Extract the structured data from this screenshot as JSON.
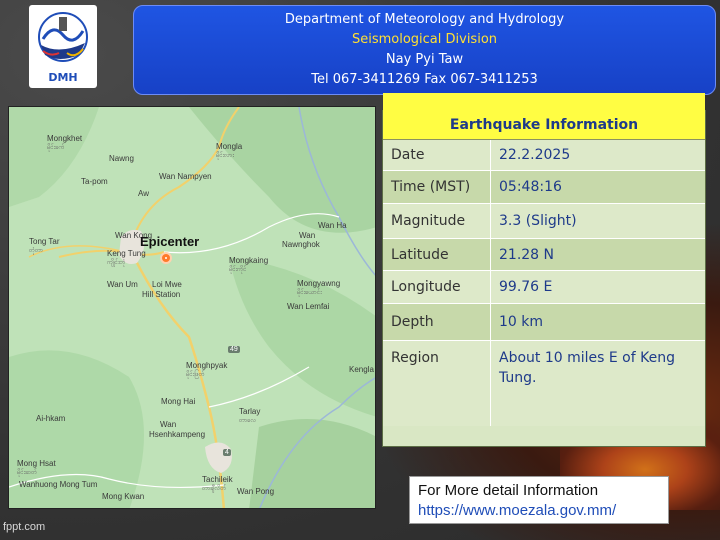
{
  "logo": {
    "text": "DMH"
  },
  "header": {
    "line1": "Department of Meteorology and Hydrology",
    "line2": "Seismological Division",
    "line3": "Nay Pyi Taw",
    "line4": "Tel 067-3411269 Fax 067-3411253"
  },
  "map": {
    "epicenter_label": "Epicenter",
    "route_shield_1": "49",
    "route_shield_2": "4",
    "places": [
      {
        "name": "Mongkhet",
        "sub": "မိုင်းခက်"
      },
      {
        "name": "Nawng",
        "sub": ""
      },
      {
        "name": "Ta-pom",
        "sub": ""
      },
      {
        "name": "Mongla",
        "sub": "မိုင်းလား"
      },
      {
        "name": "Wan Nampyen",
        "sub": ""
      },
      {
        "name": "Aw",
        "sub": ""
      },
      {
        "name": "Tong Tar",
        "sub": "တုံတာ"
      },
      {
        "name": "Wan Kong",
        "sub": ""
      },
      {
        "name": "Keng Tung",
        "sub": "ကျိုင်းတုံ"
      },
      {
        "name": "Wan Um",
        "sub": ""
      },
      {
        "name": "Loi Mwe",
        "sub": ""
      },
      {
        "name": "Hill Station",
        "sub": ""
      },
      {
        "name": "Wan Ha",
        "sub": ""
      },
      {
        "name": "Wan",
        "sub": ""
      },
      {
        "name": "Nawnghok",
        "sub": ""
      },
      {
        "name": "Mongkaing",
        "sub": "မိုင်းကိုင်"
      },
      {
        "name": "Mongyawng",
        "sub": "မိုင်းယောင်း"
      },
      {
        "name": "Wan Lemfai",
        "sub": ""
      },
      {
        "name": "Monghpyak",
        "sub": "မိုင်းဖြတ်"
      },
      {
        "name": "Mong Hai",
        "sub": ""
      },
      {
        "name": "Tarlay",
        "sub": "တာလေ"
      },
      {
        "name": "Wan",
        "sub": ""
      },
      {
        "name": "Hsenhkampeng",
        "sub": ""
      },
      {
        "name": "Ai-hkam",
        "sub": ""
      },
      {
        "name": "Kengla",
        "sub": ""
      },
      {
        "name": "Mong Hsat",
        "sub": "မိုင်းဆတ်"
      },
      {
        "name": "Wanhuong Mong Tum",
        "sub": ""
      },
      {
        "name": "Tachileik",
        "sub": "တာချီလိတ်"
      },
      {
        "name": "Mong Kwan",
        "sub": ""
      },
      {
        "name": "Wan Pong",
        "sub": ""
      }
    ]
  },
  "info": {
    "title": "Earthquake Information",
    "rows": [
      {
        "label": "Date",
        "value": "22.2.2025"
      },
      {
        "label": "Time (MST)",
        "value": "05:48:16"
      },
      {
        "label": "Magnitude",
        "value": "3.3 (Slight)"
      },
      {
        "label": "Latitude",
        "value": "21.28 N"
      },
      {
        "label": "Longitude",
        "value": "99.76 E"
      },
      {
        "label": "Depth",
        "value": "10 km"
      },
      {
        "label": "Region",
        "value": "About 10 miles E of Keng Tung."
      }
    ]
  },
  "more": {
    "text": "For More detail Information",
    "url": "https://www.moezala.gov.mm/"
  },
  "footer": {
    "credit": "fppt.com"
  },
  "colors": {
    "header_bg": "#1b48d4",
    "header_accent": "#ffe033",
    "info_title_bg": "#fffd43",
    "info_title_text": "#1e3a8a",
    "table_bg": "#d9e7c4",
    "epicenter": "#ff7a2a"
  }
}
